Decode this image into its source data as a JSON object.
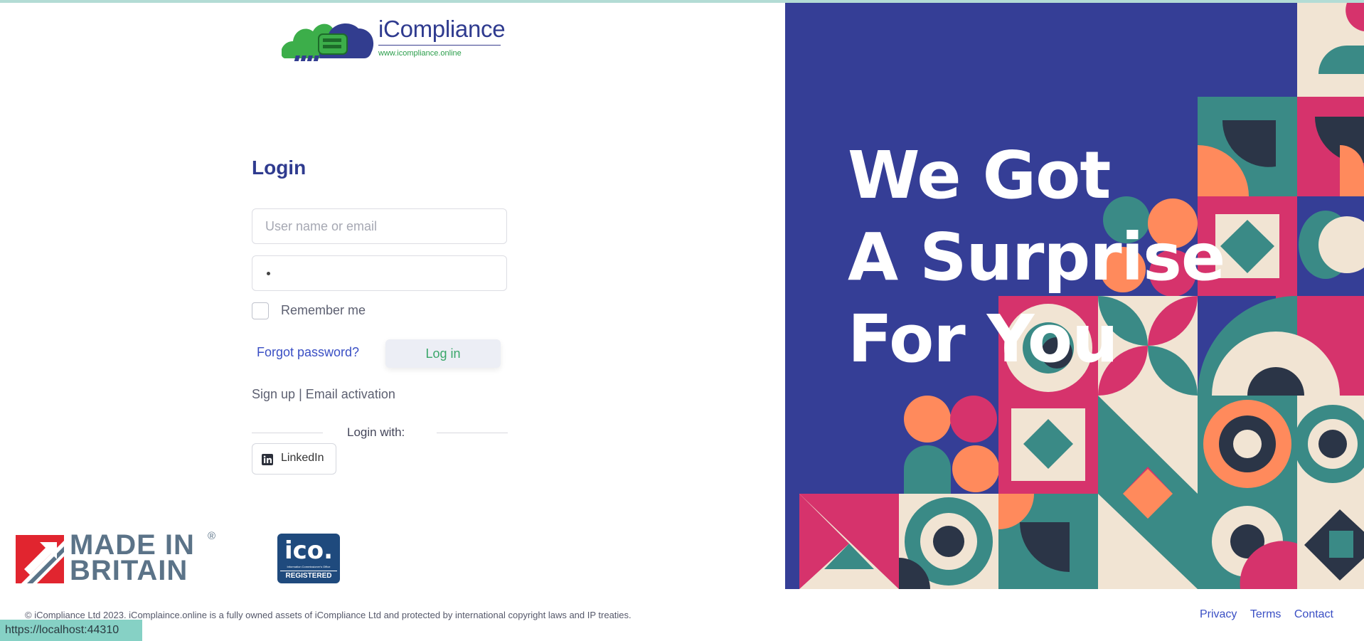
{
  "logo": {
    "name": "iCompliance",
    "url": "www.icompliance.online"
  },
  "login": {
    "title": "Login",
    "username_placeholder": "User name or email",
    "password_value": "•",
    "remember_label": "Remember me",
    "remember_checked": false,
    "forgot_label": "Forgot password?",
    "login_button": "Log in",
    "signup_label": "Sign up",
    "separator": "|",
    "activation_label": "Email activation",
    "login_with": "Login with:",
    "linkedin_label": "LinkedIn"
  },
  "badges": {
    "made_in": "MADE IN",
    "britain": "BRITAIN",
    "registered_mark": "®",
    "ico_text": "ico.",
    "ico_small": "Information Commissioner's Office",
    "ico_registered": "REGISTERED"
  },
  "hero": {
    "line1": "We Got",
    "line2": "A Surprise",
    "line3": "For You",
    "colors": {
      "background": "#353e96",
      "teal": "#3a8a86",
      "pink": "#d6336c",
      "orange": "#ff8a5c",
      "cream": "#f1e4d3",
      "navy": "#2b3547"
    }
  },
  "footer": {
    "copyright": "© iCompliance Ltd 2023. iComplaince.online is a fully owned assets of iCompliance Ltd and protected by international copyright laws and IP treaties.",
    "links": [
      "Privacy",
      "Terms",
      "Contact"
    ]
  },
  "status_url": "https://localhost:44310",
  "colors": {
    "primary": "#2f3b8f",
    "link": "#3a4fc4",
    "login_text": "#3aa76a"
  }
}
